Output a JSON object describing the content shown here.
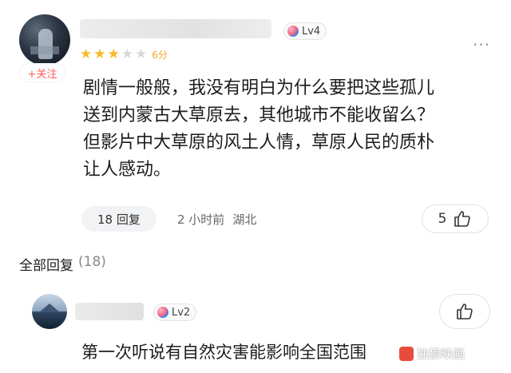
{
  "main_comment": {
    "follow_label": "+关注",
    "level": "Lv4",
    "rating": {
      "stars_filled": 3,
      "stars_total": 5,
      "score_label": "6分"
    },
    "text_lines": [
      "剧情一般般，我没有明白为什么要把这些孤儿",
      "送到内蒙古大草原去，其他城市不能收留么？",
      "但影片中大草原的风土人情，草原人民的质朴",
      "让人感动。"
    ],
    "reply_button": "18 回复",
    "time": "2 小时前",
    "location": "湖北",
    "like_count": "5",
    "more_icon": "ellipsis-icon"
  },
  "replies_section": {
    "title": "全部回复",
    "count": "(18)"
  },
  "reply": {
    "level": "Lv2",
    "text": "第一次听说有自然灾害能影响全国范围",
    "like_icon": "thumbs-up-icon"
  },
  "watermark": {
    "text": "独狼映画"
  },
  "colors": {
    "star": "#f6b923",
    "follow": "#ff5a55",
    "pill_bg": "#f2f3f5"
  }
}
